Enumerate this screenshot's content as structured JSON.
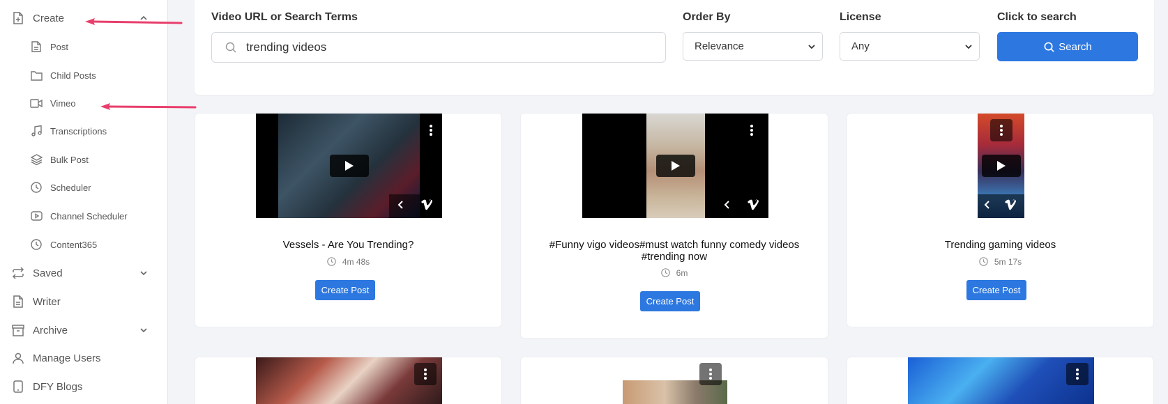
{
  "sidebar": {
    "create": {
      "label": "Create",
      "icon": "file-plus-icon"
    },
    "create_items": [
      {
        "label": "Post",
        "icon": "file-text-icon"
      },
      {
        "label": "Child Posts",
        "icon": "folder-icon"
      },
      {
        "label": "Vimeo",
        "icon": "video-icon"
      },
      {
        "label": "Transcriptions",
        "icon": "music-icon"
      },
      {
        "label": "Bulk Post",
        "icon": "layers-icon"
      },
      {
        "label": "Scheduler",
        "icon": "clock-icon"
      },
      {
        "label": "Channel Scheduler",
        "icon": "youtube-icon"
      },
      {
        "label": "Content365",
        "icon": "clock-icon"
      }
    ],
    "saved": {
      "label": "Saved",
      "icon": "repeat-icon"
    },
    "writer": {
      "label": "Writer",
      "icon": "file-text-icon"
    },
    "archive": {
      "label": "Archive",
      "icon": "archive-icon"
    },
    "manage_users": {
      "label": "Manage Users",
      "icon": "user-icon"
    },
    "dfy_blogs": {
      "label": "DFY Blogs",
      "icon": "tablet-icon"
    }
  },
  "search": {
    "url_label": "Video URL or Search Terms",
    "url_value": "trending videos",
    "order_label": "Order By",
    "order_value": "Relevance",
    "license_label": "License",
    "license_value": "Any",
    "click_label": "Click to search",
    "button_label": "Search"
  },
  "videos": [
    {
      "title": "Vessels - Are You Trending?",
      "duration": "4m 48s",
      "button": "Create Post"
    },
    {
      "title": "#Funny vigo videos#must watch funny comedy videos #trending now",
      "duration": "6m",
      "button": "Create Post"
    },
    {
      "title": "Trending gaming videos",
      "duration": "5m 17s",
      "button": "Create Post"
    }
  ],
  "colors": {
    "accent": "#2d78e0",
    "annotation_arrow": "#e83e6c"
  }
}
